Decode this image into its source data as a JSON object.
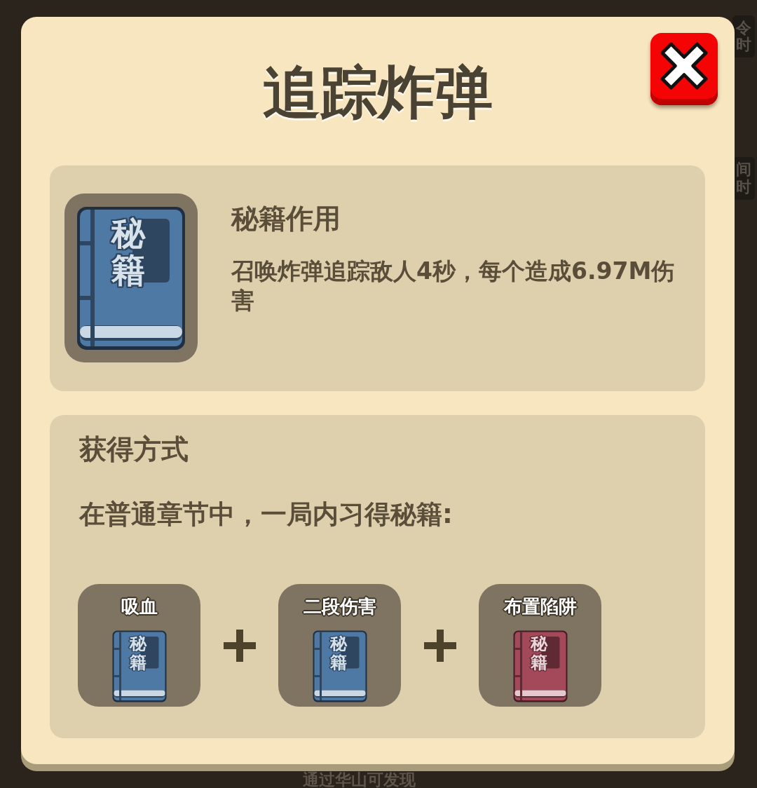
{
  "background": {
    "side_labels": [
      "令时",
      "间时"
    ],
    "footer_text": "通过华山可发现"
  },
  "dialog": {
    "title": "追踪炸弹"
  },
  "effect": {
    "heading": "秘籍作用",
    "description": "召唤炸弹追踪敌人4秒，每个造成6.97M伤害",
    "book": {
      "cover_text": "秘籍"
    }
  },
  "acquisition": {
    "heading": "获得方式",
    "instruction": "在普通章节中，一局内习得秘籍:",
    "ingredients": [
      {
        "name": "吸血",
        "cover_text": "秘籍",
        "color": "#4f79a5"
      },
      {
        "name": "二段伤害",
        "cover_text": "秘籍",
        "color": "#4f79a5"
      },
      {
        "name": "布置陷阱",
        "cover_text": "秘籍",
        "color": "#a4495a"
      }
    ]
  }
}
